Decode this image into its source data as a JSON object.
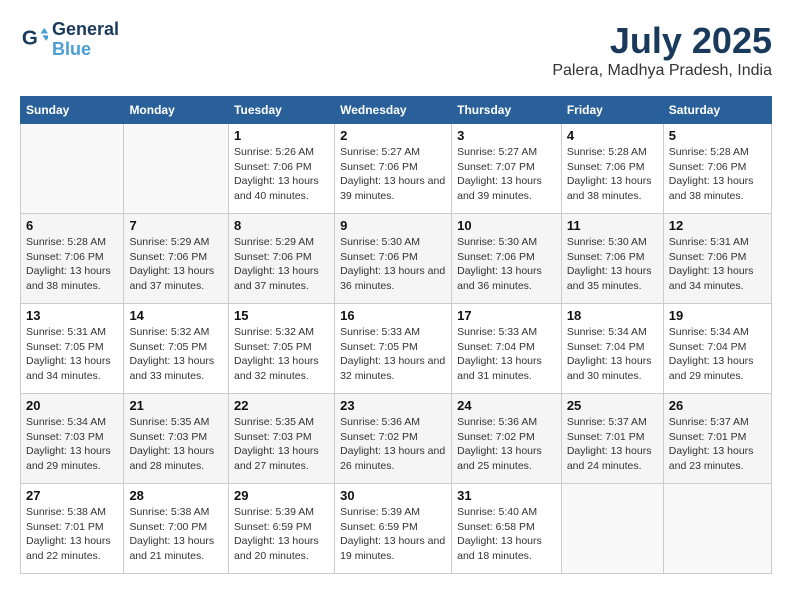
{
  "header": {
    "logo_line1": "General",
    "logo_line2": "Blue",
    "title": "July 2025",
    "subtitle": "Palera, Madhya Pradesh, India"
  },
  "days_of_week": [
    "Sunday",
    "Monday",
    "Tuesday",
    "Wednesday",
    "Thursday",
    "Friday",
    "Saturday"
  ],
  "weeks": [
    [
      {
        "num": "",
        "detail": ""
      },
      {
        "num": "",
        "detail": ""
      },
      {
        "num": "1",
        "detail": "Sunrise: 5:26 AM\nSunset: 7:06 PM\nDaylight: 13 hours and 40 minutes."
      },
      {
        "num": "2",
        "detail": "Sunrise: 5:27 AM\nSunset: 7:06 PM\nDaylight: 13 hours and 39 minutes."
      },
      {
        "num": "3",
        "detail": "Sunrise: 5:27 AM\nSunset: 7:07 PM\nDaylight: 13 hours and 39 minutes."
      },
      {
        "num": "4",
        "detail": "Sunrise: 5:28 AM\nSunset: 7:06 PM\nDaylight: 13 hours and 38 minutes."
      },
      {
        "num": "5",
        "detail": "Sunrise: 5:28 AM\nSunset: 7:06 PM\nDaylight: 13 hours and 38 minutes."
      }
    ],
    [
      {
        "num": "6",
        "detail": "Sunrise: 5:28 AM\nSunset: 7:06 PM\nDaylight: 13 hours and 38 minutes."
      },
      {
        "num": "7",
        "detail": "Sunrise: 5:29 AM\nSunset: 7:06 PM\nDaylight: 13 hours and 37 minutes."
      },
      {
        "num": "8",
        "detail": "Sunrise: 5:29 AM\nSunset: 7:06 PM\nDaylight: 13 hours and 37 minutes."
      },
      {
        "num": "9",
        "detail": "Sunrise: 5:30 AM\nSunset: 7:06 PM\nDaylight: 13 hours and 36 minutes."
      },
      {
        "num": "10",
        "detail": "Sunrise: 5:30 AM\nSunset: 7:06 PM\nDaylight: 13 hours and 36 minutes."
      },
      {
        "num": "11",
        "detail": "Sunrise: 5:30 AM\nSunset: 7:06 PM\nDaylight: 13 hours and 35 minutes."
      },
      {
        "num": "12",
        "detail": "Sunrise: 5:31 AM\nSunset: 7:06 PM\nDaylight: 13 hours and 34 minutes."
      }
    ],
    [
      {
        "num": "13",
        "detail": "Sunrise: 5:31 AM\nSunset: 7:05 PM\nDaylight: 13 hours and 34 minutes."
      },
      {
        "num": "14",
        "detail": "Sunrise: 5:32 AM\nSunset: 7:05 PM\nDaylight: 13 hours and 33 minutes."
      },
      {
        "num": "15",
        "detail": "Sunrise: 5:32 AM\nSunset: 7:05 PM\nDaylight: 13 hours and 32 minutes."
      },
      {
        "num": "16",
        "detail": "Sunrise: 5:33 AM\nSunset: 7:05 PM\nDaylight: 13 hours and 32 minutes."
      },
      {
        "num": "17",
        "detail": "Sunrise: 5:33 AM\nSunset: 7:04 PM\nDaylight: 13 hours and 31 minutes."
      },
      {
        "num": "18",
        "detail": "Sunrise: 5:34 AM\nSunset: 7:04 PM\nDaylight: 13 hours and 30 minutes."
      },
      {
        "num": "19",
        "detail": "Sunrise: 5:34 AM\nSunset: 7:04 PM\nDaylight: 13 hours and 29 minutes."
      }
    ],
    [
      {
        "num": "20",
        "detail": "Sunrise: 5:34 AM\nSunset: 7:03 PM\nDaylight: 13 hours and 29 minutes."
      },
      {
        "num": "21",
        "detail": "Sunrise: 5:35 AM\nSunset: 7:03 PM\nDaylight: 13 hours and 28 minutes."
      },
      {
        "num": "22",
        "detail": "Sunrise: 5:35 AM\nSunset: 7:03 PM\nDaylight: 13 hours and 27 minutes."
      },
      {
        "num": "23",
        "detail": "Sunrise: 5:36 AM\nSunset: 7:02 PM\nDaylight: 13 hours and 26 minutes."
      },
      {
        "num": "24",
        "detail": "Sunrise: 5:36 AM\nSunset: 7:02 PM\nDaylight: 13 hours and 25 minutes."
      },
      {
        "num": "25",
        "detail": "Sunrise: 5:37 AM\nSunset: 7:01 PM\nDaylight: 13 hours and 24 minutes."
      },
      {
        "num": "26",
        "detail": "Sunrise: 5:37 AM\nSunset: 7:01 PM\nDaylight: 13 hours and 23 minutes."
      }
    ],
    [
      {
        "num": "27",
        "detail": "Sunrise: 5:38 AM\nSunset: 7:01 PM\nDaylight: 13 hours and 22 minutes."
      },
      {
        "num": "28",
        "detail": "Sunrise: 5:38 AM\nSunset: 7:00 PM\nDaylight: 13 hours and 21 minutes."
      },
      {
        "num": "29",
        "detail": "Sunrise: 5:39 AM\nSunset: 6:59 PM\nDaylight: 13 hours and 20 minutes."
      },
      {
        "num": "30",
        "detail": "Sunrise: 5:39 AM\nSunset: 6:59 PM\nDaylight: 13 hours and 19 minutes."
      },
      {
        "num": "31",
        "detail": "Sunrise: 5:40 AM\nSunset: 6:58 PM\nDaylight: 13 hours and 18 minutes."
      },
      {
        "num": "",
        "detail": ""
      },
      {
        "num": "",
        "detail": ""
      }
    ]
  ]
}
